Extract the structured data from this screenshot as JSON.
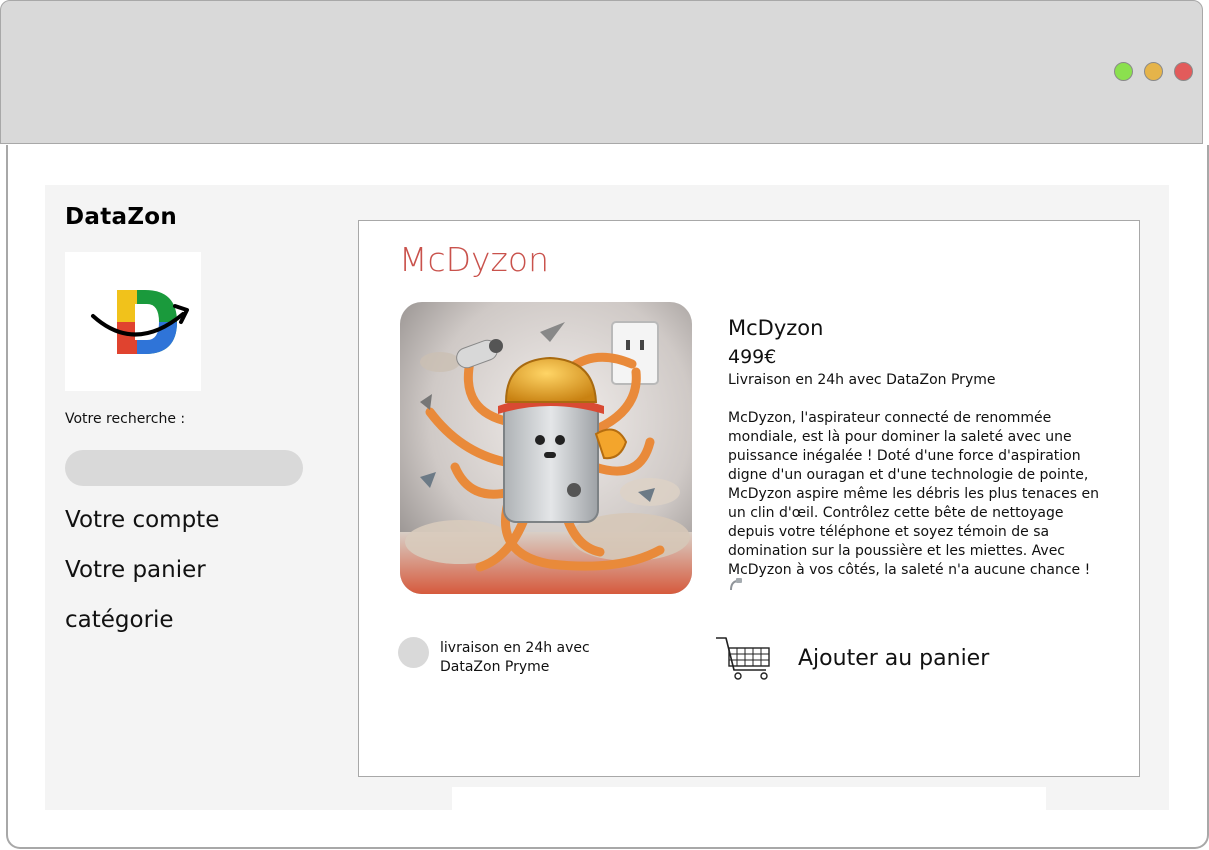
{
  "window": {
    "controls": [
      {
        "name": "maximize",
        "color": "#8be04e"
      },
      {
        "name": "minimize",
        "color": "#e5b44a"
      },
      {
        "name": "close",
        "color": "#e25b5b"
      }
    ]
  },
  "sidebar": {
    "brand": "DataZon",
    "logo_letter": "D",
    "search_label": "Votre recherche :",
    "search_value": "",
    "nav": [
      {
        "label": "Votre compte"
      },
      {
        "label": "Votre panier"
      },
      {
        "label": "catégorie"
      }
    ]
  },
  "product": {
    "heading": "McDyzon",
    "heading_color": "#c9524c",
    "image_icon": "vacuum-robot-illustration",
    "name": "McDyzon",
    "price": "499€",
    "delivery": "Livraison en 24h avec DataZon Pryme",
    "description": "McDyzon, l'aspirateur connecté de renommée mondiale, est là pour dominer  la saleté avec une puissance inégalée ! Doté d'une force d'aspiration digne d'un ouragan et d'une technologie de pointe, McDyzon aspire même  les débris les plus tenaces en un clin d'œil. Contrôlez cette bête de  nettoyage depuis votre téléphone et soyez témoin de sa domination sur la  poussière et les miettes. Avec McDyzon à vos côtés, la saleté n'a  aucune chance !",
    "option_label": "livraison en 24h avec DataZon Pryme",
    "option_selected": false,
    "cart_icon": "shopping-cart-icon",
    "add_to_cart": "Ajouter au panier"
  }
}
